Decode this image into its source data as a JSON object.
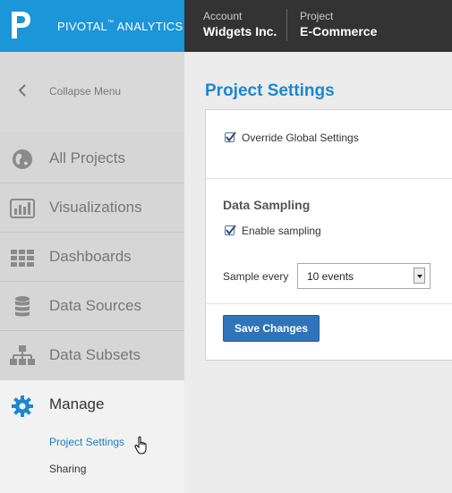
{
  "brand": {
    "name": "PIVOTAL",
    "tm": "™",
    "suffix": " ANALYTICS"
  },
  "context": {
    "account_label": "Account",
    "account_value": "Widgets Inc.",
    "project_label": "Project",
    "project_value": "E-Commerce"
  },
  "sidebar": {
    "collapse_label": "Collapse Menu",
    "items": [
      {
        "label": "All Projects",
        "icon": "globe-icon"
      },
      {
        "label": "Visualizations",
        "icon": "bar-chart-icon"
      },
      {
        "label": "Dashboards",
        "icon": "grid-icon"
      },
      {
        "label": "Data Sources",
        "icon": "database-icon"
      },
      {
        "label": "Data Subsets",
        "icon": "hierarchy-icon"
      }
    ],
    "manage": {
      "label": "Manage",
      "icon": "gear-icon",
      "sub_items": [
        "Project Settings",
        "Sharing"
      ]
    }
  },
  "main": {
    "title": "Project Settings",
    "override_label": "Override Global Settings",
    "override_checked": true,
    "sampling_title": "Data Sampling",
    "enable_sampling_label": "Enable sampling",
    "enable_sampling_checked": true,
    "sample_every_label": "Sample every",
    "sample_every_value": "10 events",
    "save_label": "Save Changes"
  },
  "colors": {
    "accent": "#1a96d9",
    "topbar": "#333333",
    "button": "#2f74b9"
  }
}
